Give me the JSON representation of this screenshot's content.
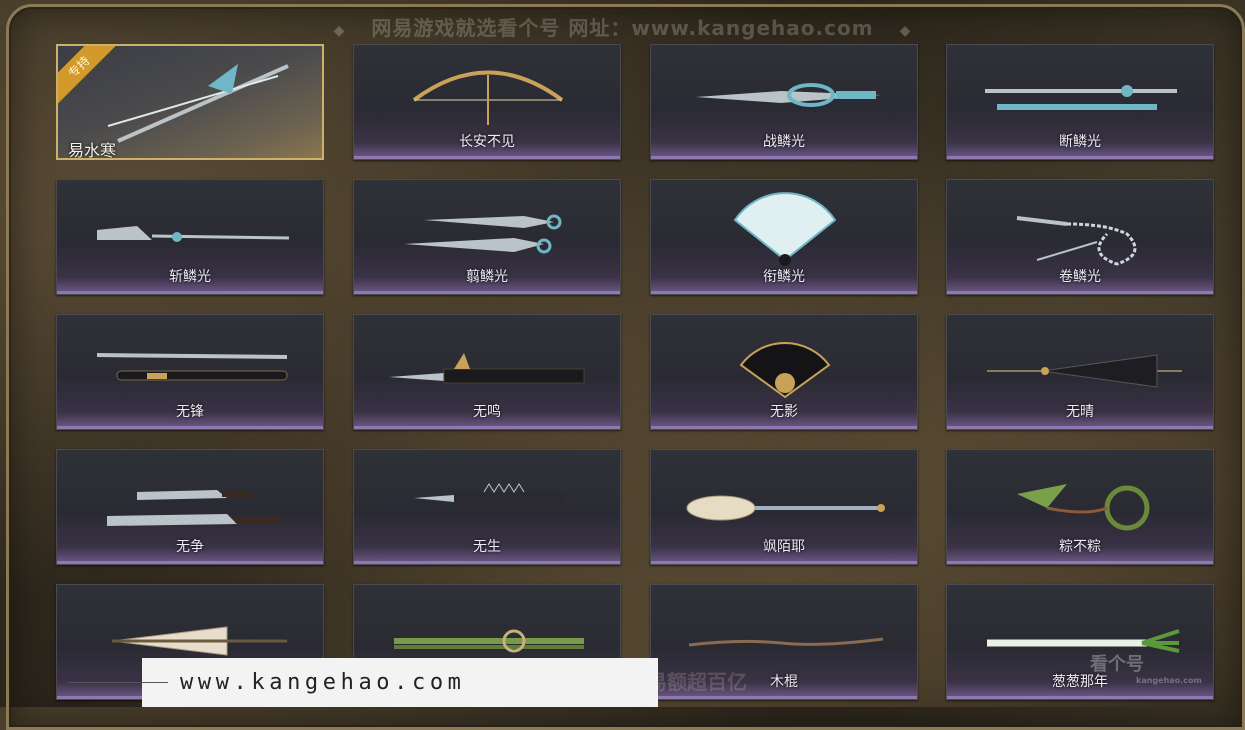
{
  "watermark_top": "网易游戏就选看个号  网址：www.kangehao.com",
  "watermark_bottom": "看个号专业网易游戏八年  年交易额超百亿",
  "brand": {
    "name": "看个号",
    "sub": "kangehao.com"
  },
  "site_url": "www.kangehao.com",
  "badge_text": "专持",
  "items": [
    {
      "name": "易水寒",
      "icon": "twin-spear-icon",
      "featured": true
    },
    {
      "name": "长安不见",
      "icon": "bow-icon"
    },
    {
      "name": "战鳞光",
      "icon": "blade-icon"
    },
    {
      "name": "断鳞光",
      "icon": "long-sword-icon"
    },
    {
      "name": "斩鳞光",
      "icon": "glaive-icon"
    },
    {
      "name": "翦鳞光",
      "icon": "twin-blades-icon"
    },
    {
      "name": "衔鳞光",
      "icon": "fan-icon"
    },
    {
      "name": "卷鳞光",
      "icon": "chain-whip-icon"
    },
    {
      "name": "无锋",
      "icon": "sword-and-scabbard-icon"
    },
    {
      "name": "无鸣",
      "icon": "dark-spear-icon"
    },
    {
      "name": "无影",
      "icon": "black-fan-icon"
    },
    {
      "name": "无晴",
      "icon": "umbrella-icon"
    },
    {
      "name": "无争",
      "icon": "twin-sabres-icon"
    },
    {
      "name": "无生",
      "icon": "spiked-spear-icon"
    },
    {
      "name": "飒陌耶",
      "icon": "spoon-icon"
    },
    {
      "name": "粽不粽",
      "icon": "zongzi-whip-icon"
    },
    {
      "name": "",
      "icon": "paper-umbrella-icon"
    },
    {
      "name": "",
      "icon": "bamboo-icon"
    },
    {
      "name": "木棍",
      "icon": "wooden-stick-icon"
    },
    {
      "name": "葱葱那年",
      "icon": "scallion-icon"
    }
  ]
}
